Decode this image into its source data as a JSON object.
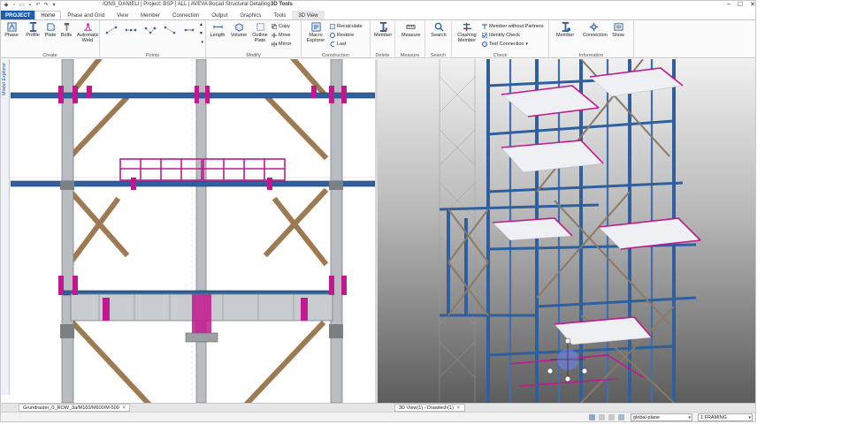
{
  "window": {
    "title": "/ONS_DANIELI | Project: BSP | ALL | AVEVA Bocad Structural Detailing",
    "context_tab_group": "3D Tools",
    "minimize": "–",
    "maximize": "☐",
    "close": "✕"
  },
  "tabs": [
    "PROJECT",
    "Home",
    "Phase and Grid",
    "View",
    "Member",
    "Connection",
    "Output",
    "Graphics",
    "Tools",
    "3D View"
  ],
  "ribbon": {
    "create": {
      "label": "Create",
      "buttons": [
        "Phase",
        "Profile",
        "Plate",
        "Bolts",
        "Automatic Weld"
      ]
    },
    "points": {
      "label": "Points"
    },
    "modify": {
      "label": "Modify",
      "buttons": [
        "Length",
        "Volume",
        "Outline Plate"
      ],
      "small": [
        "Copy",
        "Move",
        "Mirror"
      ]
    },
    "construction": {
      "label": "Construction",
      "button": "Macro Explorer",
      "small": [
        "Recalculate",
        "Restore",
        "Last"
      ]
    },
    "delete": {
      "label": "Delete",
      "button": "Member"
    },
    "measure": {
      "label": "Measure",
      "button": "Measure"
    },
    "search": {
      "label": "Search",
      "button": "Search"
    },
    "check": {
      "label": "Check",
      "button": "Clashing Member",
      "small": [
        "Member without Partners",
        "Identity Check",
        "Test Connection"
      ]
    },
    "information": {
      "label": "Information",
      "buttons": [
        "Member",
        "Connection",
        "Show"
      ]
    }
  },
  "sidebar": {
    "label": "Model Explorer"
  },
  "doc_tabs": [
    "Grundraster_0_ROW_3a/M160/M600/M-500",
    "3D View(1) - Drawtech(1)"
  ],
  "status": {
    "plane": "global-plane",
    "phase": "1 FRAMING"
  },
  "colors": {
    "accent": "#1a5fb4",
    "beam_blue": "#2f5f9c",
    "railing_magenta": "#c2188f",
    "brace_tan": "#9e7a52"
  }
}
